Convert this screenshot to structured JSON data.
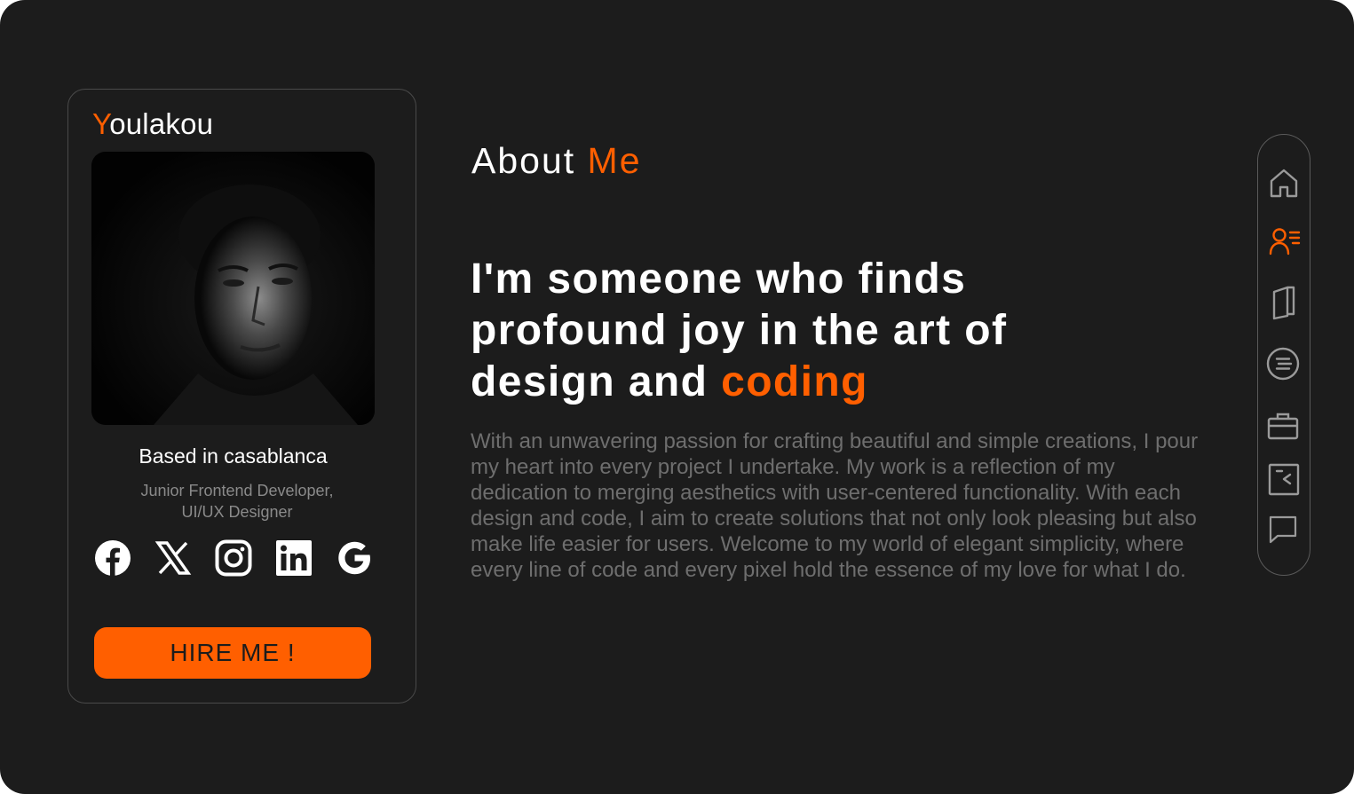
{
  "profile": {
    "brand_first": "Y",
    "brand_rest": "oulakou",
    "photo_alt": "Portrait photo",
    "location": "Based in casablanca",
    "role_line1": "Junior Frontend Developer,",
    "role_line2": "UI/UX Designer",
    "socials": [
      {
        "icon": "facebook-icon"
      },
      {
        "icon": "x-icon"
      },
      {
        "icon": "instagram-icon"
      },
      {
        "icon": "linkedin-icon"
      },
      {
        "icon": "google-icon"
      }
    ],
    "hire_label": "HIRE  ME !"
  },
  "about": {
    "title_white": "About ",
    "title_accent": "Me",
    "headline_line1": "I'm someone who finds",
    "headline_line2": "profound joy in the art of",
    "headline_line3_white": "design and ",
    "headline_line3_accent": "coding",
    "bio": "With an unwavering passion for crafting beautiful and simple creations, I pour my heart into every project I undertake. My work is a reflection of my dedication to merging aesthetics with user-centered functionality. With each design and code, I aim to create solutions that not only look pleasing but also make life easier for users. Welcome to my world of elegant simplicity, where every line of code and every pixel hold the essence of my love for what I do."
  },
  "nav": {
    "items": [
      {
        "icon": "home-icon",
        "active": false
      },
      {
        "icon": "user-profile-icon",
        "active": true
      },
      {
        "icon": "book-icon",
        "active": false
      },
      {
        "icon": "list-circle-icon",
        "active": false
      },
      {
        "icon": "briefcase-icon",
        "active": false
      },
      {
        "icon": "code-window-icon",
        "active": false
      },
      {
        "icon": "chat-bubble-icon",
        "active": false
      }
    ]
  },
  "colors": {
    "accent": "#ff5f00",
    "background": "#1c1c1c",
    "text": "#ffffff",
    "muted": "#6e6e6e"
  }
}
